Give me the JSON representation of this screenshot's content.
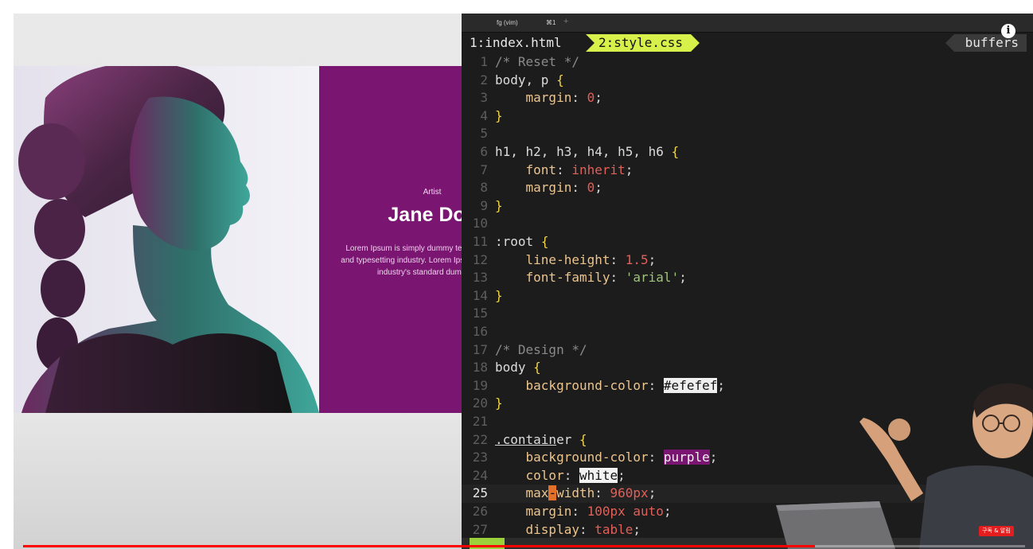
{
  "preview": {
    "card": {
      "label": "Artist",
      "name": "Jane Doe",
      "bio": "Lorem Ipsum is simply dummy text of the printing and typesetting industry. Lorem Ipsum has been the industry's standard dummy text"
    },
    "colors": {
      "card_bg": "#7a1672",
      "page_bg": "#efefef"
    }
  },
  "terminal": {
    "tab_title": "fg (vim)",
    "tab_shortcut": "⌘1",
    "new_tab": "+",
    "vim_tabs": [
      "1:index.html",
      "2:style.css"
    ],
    "active_tab": 1,
    "buffers_label": "buffers",
    "current_line": 25,
    "lines": [
      {
        "n": "1",
        "html": "<span class=\"cmt\">/* Reset */</span>"
      },
      {
        "n": "2",
        "html": "<span class=\"sel\">body, p</span> <span class=\"brace\">{</span>"
      },
      {
        "n": "3",
        "html": "    <span class=\"prop\">margin</span>: <span class=\"num\">0</span>;"
      },
      {
        "n": "4",
        "html": "<span class=\"brace\">}</span>"
      },
      {
        "n": "5",
        "html": ""
      },
      {
        "n": "6",
        "html": "<span class=\"sel\">h1, h2, h3, h4, h5, h6</span> <span class=\"brace\">{</span>"
      },
      {
        "n": "7",
        "html": "    <span class=\"prop\">font</span>: <span class=\"kw\">inherit</span>;"
      },
      {
        "n": "8",
        "html": "    <span class=\"prop\">margin</span>: <span class=\"num\">0</span>;"
      },
      {
        "n": "9",
        "html": "<span class=\"brace\">}</span>"
      },
      {
        "n": "10",
        "html": ""
      },
      {
        "n": "11",
        "html": "<span class=\"sel\">:root</span> <span class=\"brace\">{</span>"
      },
      {
        "n": "12",
        "html": "    <span class=\"prop\">line-height</span>: <span class=\"num\">1.5</span>;"
      },
      {
        "n": "13",
        "html": "    <span class=\"prop\">font-family</span>: <span class=\"str\">'arial'</span>;"
      },
      {
        "n": "14",
        "html": "<span class=\"brace\">}</span>"
      },
      {
        "n": "15",
        "html": ""
      },
      {
        "n": "16",
        "html": ""
      },
      {
        "n": "17",
        "html": "<span class=\"cmt\">/* Design */</span>"
      },
      {
        "n": "18",
        "html": "<span class=\"sel\">body</span> <span class=\"brace\">{</span>"
      },
      {
        "n": "19",
        "html": "    <span class=\"prop\">background-color</span>: <span class=\"hl-ef\">#efefef</span>;"
      },
      {
        "n": "20",
        "html": "<span class=\"brace\">}</span>"
      },
      {
        "n": "21",
        "html": ""
      },
      {
        "n": "22",
        "html": "<span class=\"sel underline\">.contain</span><span class=\"sel\">er</span> <span class=\"brace\">{</span>"
      },
      {
        "n": "23",
        "html": "    <span class=\"prop\">background-color</span>: <span class=\"hl-purple\">purple</span>;"
      },
      {
        "n": "24",
        "html": "    <span class=\"prop\">color</span>: <span class=\"hl-white\">white</span>;"
      },
      {
        "n": "25",
        "html": "    <span class=\"prop\">max</span><span class=\"cursor\">-</span><span class=\"prop\">width</span>: <span class=\"num\">960px</span>;"
      },
      {
        "n": "26",
        "html": "    <span class=\"prop\">margin</span>: <span class=\"num\">100px</span> <span class=\"kw\">auto</span>;"
      },
      {
        "n": "27",
        "html": "    <span class=\"prop\">display</span>: <span class=\"kw\">table</span>;"
      }
    ]
  },
  "overlay": {
    "badge": "구독 & 알림",
    "progress": 0.79
  }
}
